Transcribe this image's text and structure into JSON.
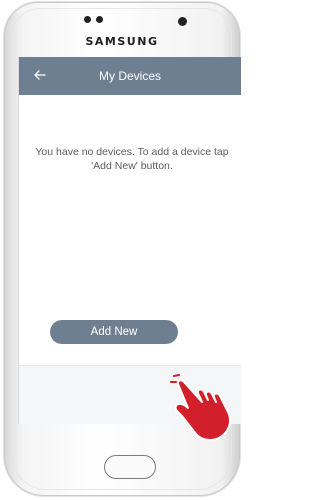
{
  "device": {
    "brand": "SAMSUNG"
  },
  "appbar": {
    "title": "My Devices",
    "back_icon": "arrow-left-icon"
  },
  "main": {
    "empty_message": "You have no devices. To add a device tap 'Add New' button."
  },
  "footer": {
    "add_button_label": "Add New"
  },
  "colors": {
    "appbar": "#6f7f92",
    "button": "#6f7f92",
    "hand": "#d11f2b"
  },
  "overlay": {
    "pointer_icon": "hand-pointer-icon"
  }
}
